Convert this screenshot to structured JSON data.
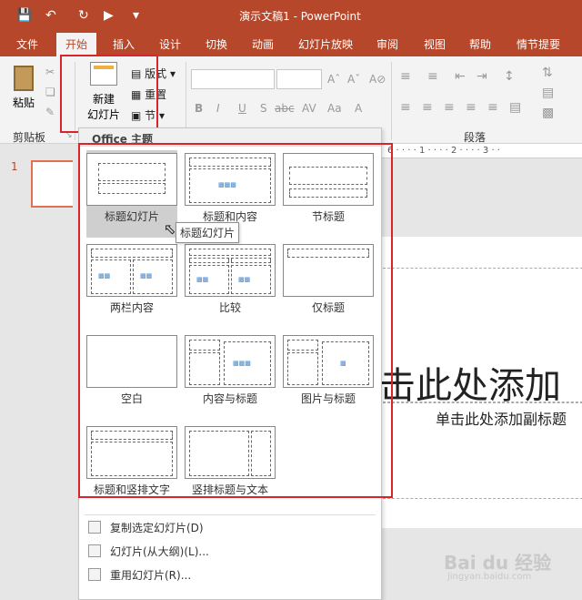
{
  "window": {
    "title": "演示文稿1 - PowerPoint",
    "qa_icons": [
      "save-icon",
      "undo-icon",
      "redo-icon",
      "present-icon",
      "customize-icon"
    ]
  },
  "tabs": [
    "文件",
    "开始",
    "插入",
    "设计",
    "切换",
    "动画",
    "幻灯片放映",
    "审阅",
    "视图",
    "帮助",
    "情节提要"
  ],
  "active_tab": "开始",
  "ribbon": {
    "paste": "粘贴",
    "clipboard_group": "剪贴板",
    "new_slide_line1": "新建",
    "new_slide_line2": "幻灯片",
    "layout": "版式",
    "reset": "重置",
    "section": "节",
    "paragraph_group": "段落",
    "font_buttons": [
      "B",
      "I",
      "U",
      "S",
      "abc",
      "AV",
      "Aa",
      "A"
    ]
  },
  "dropdown": {
    "header": "Office 主题",
    "layouts": [
      {
        "name": "标题幻灯片"
      },
      {
        "name": "标题和内容"
      },
      {
        "name": "节标题"
      },
      {
        "name": "两栏内容"
      },
      {
        "name": "比较"
      },
      {
        "name": "仅标题"
      },
      {
        "name": "空白"
      },
      {
        "name": "内容与标题"
      },
      {
        "name": "图片与标题"
      },
      {
        "name": "标题和竖排文字"
      },
      {
        "name": "竖排标题与文本"
      }
    ],
    "menu": [
      "复制选定幻灯片(D)",
      "幻灯片(从大纲)(L)...",
      "重用幻灯片(R)..."
    ],
    "tooltip": "标题幻灯片"
  },
  "slide": {
    "thumb_number": "1",
    "title_placeholder": "击此处添加",
    "subtitle_placeholder": "单击此处添加副标题",
    "ruler_ticks": "6 · · · · 1 · · · · 2 · · · · 3 · ·"
  },
  "watermark": {
    "logo": "Bai du 经验",
    "url": "jingyan.baidu.com"
  },
  "colors": {
    "brand": "#b7472a",
    "highlight": "#d9242b"
  }
}
